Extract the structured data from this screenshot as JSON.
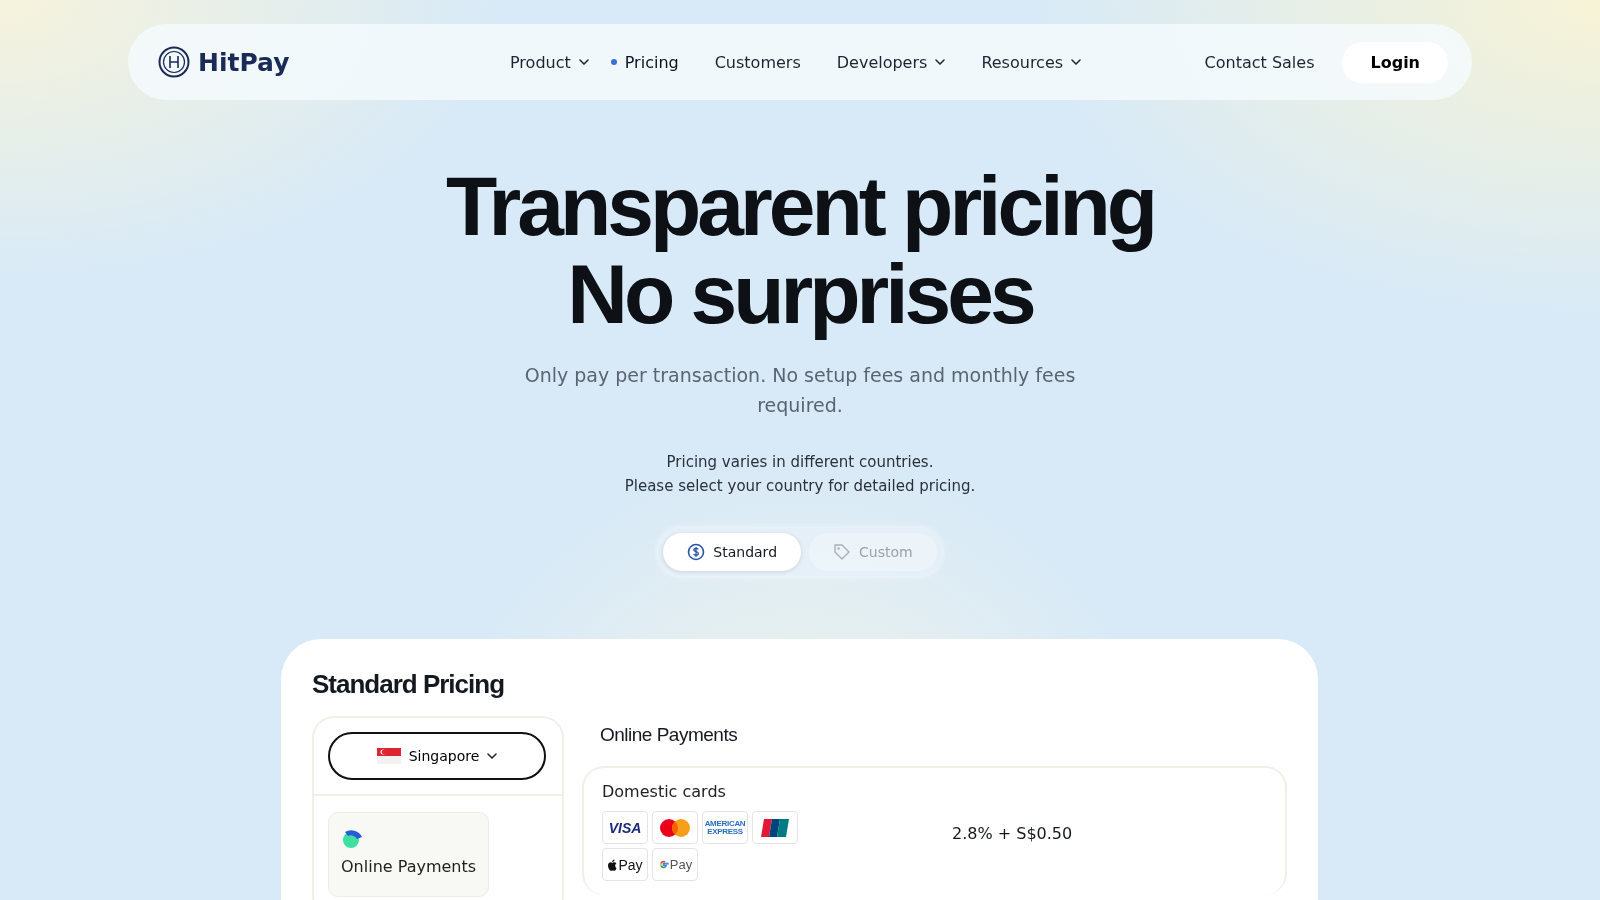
{
  "nav": {
    "brand": "HitPay",
    "items": [
      {
        "label": "Product",
        "dropdown": true,
        "selected": false
      },
      {
        "label": "Pricing",
        "dropdown": false,
        "selected": true
      },
      {
        "label": "Customers",
        "dropdown": false,
        "selected": false
      },
      {
        "label": "Developers",
        "dropdown": true,
        "selected": false
      },
      {
        "label": "Resources",
        "dropdown": true,
        "selected": false
      }
    ],
    "contact": "Contact Sales",
    "login": "Login"
  },
  "hero": {
    "title_lines": [
      "Transparent pricing",
      "No surprises"
    ],
    "subtitle": "Only pay per transaction. No setup fees and monthly fees required.",
    "note_lines": [
      "Pricing varies in different countries.",
      "Please select your country for detailed pricing."
    ]
  },
  "plan_tabs": [
    {
      "label": "Standard",
      "kind": "dollar",
      "selected": true
    },
    {
      "label": "Custom",
      "kind": "tag",
      "selected": false
    }
  ],
  "pricing": {
    "title": "Standard Pricing",
    "country": "Singapore",
    "categories": [
      {
        "label": "Online Payments",
        "selected": true
      }
    ],
    "section_title": "Online Payments",
    "rows": [
      {
        "title": "Domestic cards",
        "price": "2.8% + S$0.50",
        "methods": [
          {
            "kind": "visa",
            "label": "VISA"
          },
          {
            "kind": "mastercard"
          },
          {
            "kind": "amex",
            "label": "AMERICAN EXPRESS"
          },
          {
            "kind": "unionpay"
          },
          {
            "kind": "applepay",
            "label": "Pay"
          },
          {
            "kind": "gpay",
            "label": "Pay"
          }
        ]
      }
    ]
  }
}
